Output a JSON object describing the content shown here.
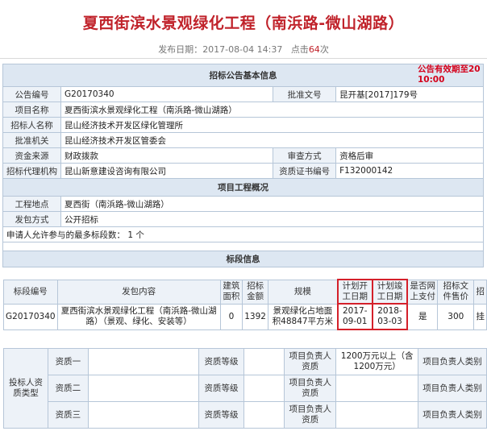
{
  "header": {
    "title": "夏西街滨水景观绿化工程（南浜路-微山湖路）",
    "publish_label": "发布日期：",
    "publish_date": "2017-08-04 14:37",
    "clicks_label": "点击",
    "clicks": "64",
    "clicks_suffix": "次"
  },
  "notice": {
    "line1": "公告有效期至20",
    "line2": "10:00"
  },
  "basic_info": {
    "section_title": "招标公告基本信息",
    "announcement_no_label": "公告编号",
    "announcement_no": "G20170340",
    "approval_doc_label": "批准文号",
    "approval_doc": "昆开基[2017]179号",
    "project_name_label": "项目名称",
    "project_name": "夏西街滨水景观绿化工程（南浜路-微山湖路）",
    "tenderer_label": "招标人名称",
    "tenderer": "昆山经济技术开发区绿化管理所",
    "approval_org_label": "批准机关",
    "approval_org": "昆山经济技术开发区管委会",
    "fund_source_label": "资金来源",
    "fund_source": "财政拨款",
    "review_method_label": "审查方式",
    "review_method": "资格后审",
    "agency_label": "招标代理机构",
    "agency": "昆山新意建设咨询有限公司",
    "cert_no_label": "资质证书编号",
    "cert_no": "F132000142"
  },
  "project_overview": {
    "section_title": "项目工程概况",
    "location_label": "工程地点",
    "location": "夏西街（南浜路-微山湖路）",
    "contract_method_label": "发包方式",
    "contract_method": "公开招标",
    "max_sections_text": "申请人允许参与的最多标段数： 1 个"
  },
  "section_info": {
    "section_title": "标段信息",
    "columns": [
      "标段编号",
      "发包内容",
      "建筑面积",
      "招标金额",
      "规模",
      "计划开工日期",
      "计划竣工日期",
      "是否网上支付",
      "招标文件售价",
      "招"
    ],
    "row": {
      "section_no": "G20170340",
      "content": "夏西街滨水景观绿化工程（南浜路-微山湖路）（景观、绿化、安装等）",
      "area": "0",
      "amount": "1392",
      "scale": "景观绿化占地面积48847平方米",
      "start_date": "2017-09-01",
      "end_date": "2018-03-03",
      "online_pay": "是",
      "doc_price": "300",
      "extra": "挂"
    }
  },
  "qualification": {
    "group_label": "投标人资质类型",
    "rows": [
      {
        "label": "资质一",
        "grade_label": "资质等级",
        "manager_label": "项目负责人资质",
        "manager_value": "1200万元以上（含1200万元）",
        "category_label": "项目负责人类别"
      },
      {
        "label": "资质二",
        "grade_label": "资质等级",
        "manager_label": "项目负责人资质",
        "manager_value": "",
        "category_label": "项目负责人类别"
      },
      {
        "label": "资质三",
        "grade_label": "资质等级",
        "manager_label": "项目负责人资质",
        "manager_value": "",
        "category_label": "项目负责人类别"
      }
    ]
  },
  "colors": {
    "title_red": "#c0222a",
    "header_bg": "#dde7f2",
    "label_bg": "#edf2f8",
    "border": "#b6c6d8",
    "highlight_border": "#d4202a"
  }
}
